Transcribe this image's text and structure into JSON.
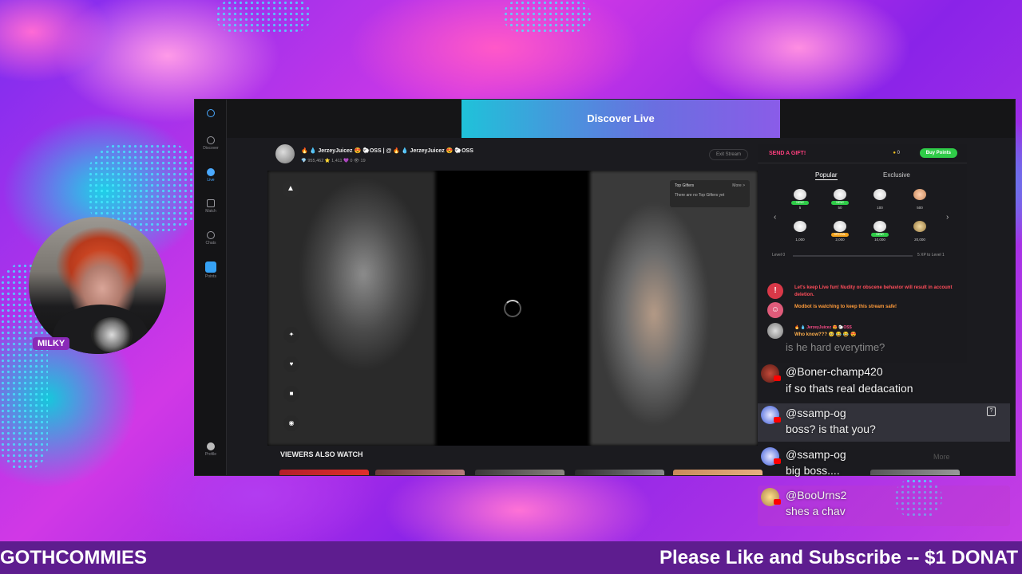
{
  "overlay": {
    "webcam_label": "MILKY",
    "ticker_left": "GOTHCOMMIES",
    "ticker_right": "Please Like and Subscribe -- $1 DONAT"
  },
  "app": {
    "banner_title": "Discover Live",
    "rail": {
      "discover": "Discover",
      "live": "Live",
      "match": "Match",
      "chats": "Chats",
      "points": "Points",
      "profile": "Profile"
    },
    "stream": {
      "streamer_name": "🔥 💧 JerzeyJuicez 😍 🐑OSS | @ 🔥 💧 JerzeyJuicez 😍 🐑OSS",
      "stats": "💎 955,462   ⭐ 1,411   💜 0   👁 19",
      "exit_label": "Exit Stream",
      "top_gifters_title": "Top Gifters",
      "top_gifters_more": "More >",
      "top_gifters_empty": "There are no Top Gifters yet"
    },
    "viewers_also_watch": "VIEWERS ALSO WATCH",
    "more_label": "More",
    "gift_panel": {
      "send_gift": "SEND A GIFT!",
      "coins": "0",
      "buy_points": "Buy Points",
      "tabs": [
        "Popular",
        "Exclusive"
      ],
      "gifts": [
        {
          "badge": "NEW!",
          "price": "5"
        },
        {
          "badge": "NEW!",
          "price": "50"
        },
        {
          "badge": "",
          "price": "100"
        },
        {
          "badge": "",
          "price": "500"
        },
        {
          "badge": "",
          "price": "1,000"
        },
        {
          "badge": "SPECIAL",
          "price": "2,000"
        },
        {
          "badge": "NEW!",
          "price": "10,000"
        },
        {
          "badge": "",
          "price": "20,000"
        }
      ],
      "level_left": "Level 0",
      "level_right": "5 XP to Level 1"
    },
    "system_messages": [
      {
        "text": "Let's keep Live fun! Nudity or obscene behavior will result in account deletion.",
        "color": "#ff4d5a"
      },
      {
        "text": "Modbot is watching to keep this stream safe!",
        "color": "#ff9b3a"
      },
      {
        "user": "🔥 💧 JerzeyJuicez 😍 🐑OSS",
        "text": "Who know??? 🥺 😂 😂 😍",
        "color": "#ff4d8a"
      }
    ]
  },
  "chat": {
    "faded_message": "is he hard everytime?",
    "messages": [
      {
        "user": "@Boner-champ420",
        "text": "if so thats real dedacation"
      },
      {
        "user": "@ssamp-og",
        "text": "boss? is that you?"
      },
      {
        "user": "@ssamp-og",
        "text": "big boss...."
      },
      {
        "user": "@BooUrns2",
        "text": "shes a chav"
      }
    ]
  }
}
